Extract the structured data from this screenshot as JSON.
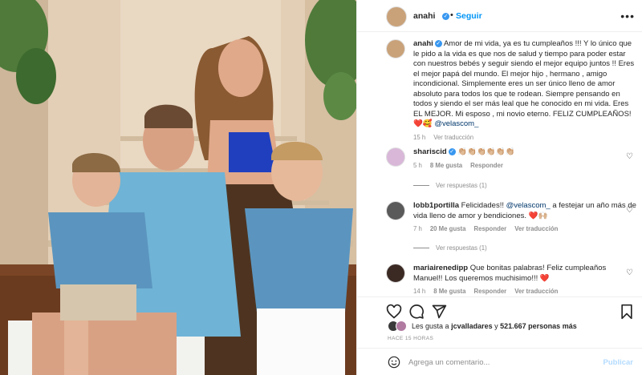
{
  "colors": {
    "accent": "#0095f6",
    "verified": "#3897f0",
    "heart": "#ed4956",
    "muted": "#8e8e8e",
    "text": "#262626"
  },
  "post": {
    "author": "anahi",
    "follow_label": "Seguir",
    "separator": "•",
    "more_icon": "ellipsis-icon",
    "caption": {
      "username": "anahi",
      "text": "Amor de mi vida, ya es tu cumpleaños !!! Y lo único que le pido a la vida es que nos de salud y tiempo para poder estar con nuestros bebés y seguir siendo el mejor equipo juntos !! Eres el mejor papá del mundo. El mejor hijo , hermano , amigo incondicional. Simplemente eres un ser único lleno de amor absoluto para todos los que te rodean. Siempre pensando en todos y siendo el ser más leal que he conocido en mi vida. Eres EL MEJOR. Mi esposo , mi novio eterno. FELIZ CUMPLEAÑOS!",
      "end_emojis": "❤️🥰",
      "mention": "@velascom_",
      "time": "15 h",
      "translate": "Ver traducción"
    },
    "comments": [
      {
        "username": "shariscid",
        "text": "👏🏼👏🏼👏🏼👏🏼👏🏼👏🏼",
        "time": "5 h",
        "likes": "8 Me gusta",
        "reply": "Responder",
        "replies": "Ver respuestas (1)"
      },
      {
        "username": "lobb1portilla",
        "text_before": "Felicidades!!",
        "mention": "@velascom_",
        "text_after": "a festejar un año más de vida lleno de amor y bendiciones. ❤️🙌🏼",
        "time": "7 h",
        "likes": "20 Me gusta",
        "reply": "Responder",
        "translate": "Ver traducción",
        "replies": "Ver respuestas (1)"
      },
      {
        "username": "mariairenedipp",
        "text": "Que bonitas palabras! Feliz cumpleaños Manuel!! Los queremos muchisimo!!! ❤️",
        "time": "14 h",
        "likes": "8 Me gusta",
        "reply": "Responder",
        "translate": "Ver traducción"
      }
    ],
    "actions": {
      "like_icon": "heart-icon",
      "comment_icon": "comment-icon",
      "share_icon": "share-icon",
      "save_icon": "bookmark-icon"
    },
    "likes": {
      "prefix": "Les gusta a",
      "user": "jcvalladares",
      "conj": "y",
      "count": "521.667 personas más"
    },
    "timestamp": "HACE 15 HORAS",
    "add_comment": {
      "placeholder": "Agrega un comentario...",
      "publish": "Publicar"
    }
  }
}
